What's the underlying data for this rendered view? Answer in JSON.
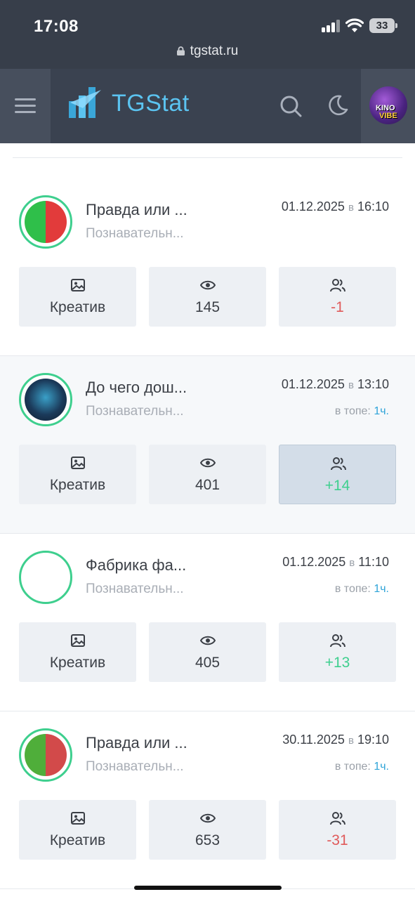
{
  "status_bar": {
    "time": "17:08",
    "battery": "33",
    "url": "tgstat.ru"
  },
  "header": {
    "brand": "TGStat",
    "accent": "#5bc3f0",
    "avatar_line1": "KINO",
    "avatar_line2": "VIBE"
  },
  "colors": {
    "ring": "#3ecf8e",
    "negative": "#e05a5a",
    "positive": "#3ecf8e",
    "link": "#2fa4d8"
  },
  "cards": [
    {
      "title": "Правда или ...",
      "category": "Познавательн...",
      "date": "01.12.2025",
      "at": "в",
      "time": "16:10",
      "top_label": "",
      "top_value": "",
      "creative": "Креатив",
      "views": "145",
      "subs": "-1",
      "subs_sign": "negative"
    },
    {
      "title": "До чего дош...",
      "category": "Познавательн...",
      "date": "01.12.2025",
      "at": "в",
      "time": "13:10",
      "top_label": "в топе:",
      "top_value": "1ч.",
      "creative": "Креатив",
      "views": "401",
      "subs": "+14",
      "subs_sign": "positive"
    },
    {
      "title": "Фабрика фа...",
      "category": "Познавательн...",
      "date": "01.12.2025",
      "at": "в",
      "time": "11:10",
      "top_label": "в топе:",
      "top_value": "1ч.",
      "creative": "Креатив",
      "views": "405",
      "subs": "+13",
      "subs_sign": "positive"
    },
    {
      "title": "Правда или ...",
      "category": "Познавательн...",
      "date": "30.11.2025",
      "at": "в",
      "time": "19:10",
      "top_label": "в топе:",
      "top_value": "1ч.",
      "creative": "Креатив",
      "views": "653",
      "subs": "-31",
      "subs_sign": "negative"
    }
  ]
}
